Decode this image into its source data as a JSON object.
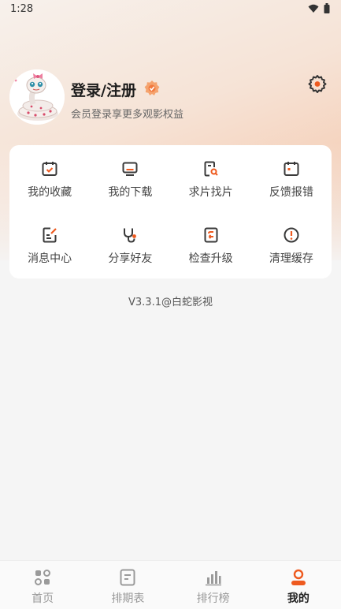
{
  "colors": {
    "accent": "#ee5a1f",
    "icon_dark": "#3a3a3a",
    "inactive": "#999999"
  },
  "status_bar": {
    "time": "1:28"
  },
  "profile": {
    "title": "登录/注册",
    "subtitle": "会员登录享更多观影权益"
  },
  "menu": [
    {
      "label": "我的收藏",
      "icon": "calendar-check-icon"
    },
    {
      "label": "我的下载",
      "icon": "monitor-icon"
    },
    {
      "label": "求片找片",
      "icon": "document-search-icon"
    },
    {
      "label": "反馈报错",
      "icon": "calendar-alert-icon"
    },
    {
      "label": "消息中心",
      "icon": "edit-note-icon"
    },
    {
      "label": "分享好友",
      "icon": "stethoscope-icon"
    },
    {
      "label": "检查升级",
      "icon": "update-icon"
    },
    {
      "label": "清理缓存",
      "icon": "alert-circle-icon"
    }
  ],
  "version": "V3.3.1@白蛇影视",
  "tabs": [
    {
      "label": "首页",
      "icon": "grid-icon"
    },
    {
      "label": "排期表",
      "icon": "schedule-icon"
    },
    {
      "label": "排行榜",
      "icon": "bar-chart-icon"
    },
    {
      "label": "我的",
      "icon": "user-icon",
      "active": true
    }
  ]
}
